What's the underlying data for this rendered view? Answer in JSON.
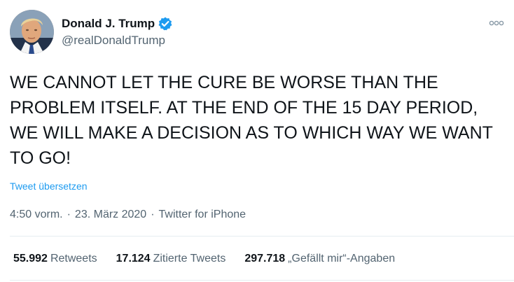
{
  "author": {
    "name": "Donald J. Trump",
    "handle": "@realDonaldTrump",
    "verified": true,
    "avatar_icon": "profile-photo"
  },
  "menu_icon": "more-options-icon",
  "tweet": {
    "text": "WE CANNOT LET THE CURE BE WORSE THAN THE PROBLEM ITSELF. AT THE END OF THE 15 DAY PERIOD, WE WILL MAKE A DECISION AS TO WHICH WAY WE WANT TO GO!",
    "translate_label": "Tweet übersetzen"
  },
  "meta": {
    "time": "4:50 vorm.",
    "separator": "·",
    "date": "23. März 2020",
    "source": "Twitter for iPhone"
  },
  "stats": {
    "retweets": {
      "value": "55.992",
      "label": "Retweets"
    },
    "quotes": {
      "value": "17.124",
      "label": "Zitierte Tweets"
    },
    "likes": {
      "value": "297.718",
      "label": "„Gefällt mir“-Angaben"
    }
  },
  "colors": {
    "accent": "#1d9bf0",
    "text": "#0f1419",
    "secondary": "#536471",
    "divider": "#e6ecf0"
  }
}
